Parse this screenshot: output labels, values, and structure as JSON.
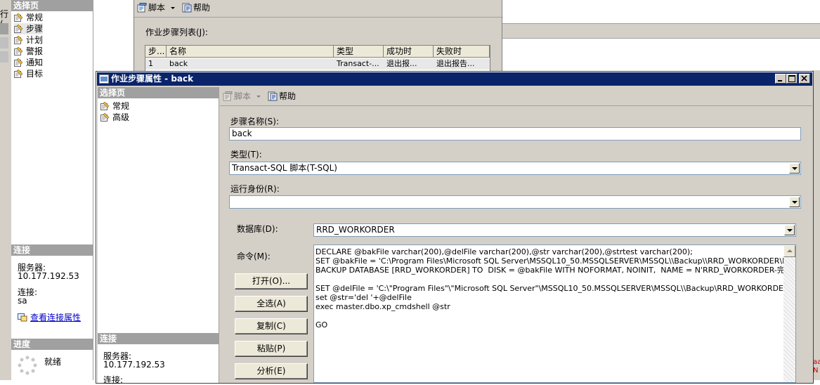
{
  "back_window": {
    "left_nav": {
      "header": "选择页",
      "items": [
        "常规",
        "步骤",
        "计划",
        "警报",
        "通知",
        "目标"
      ],
      "selected_index": 1,
      "edge_text": "行("
    },
    "toolbar": {
      "script_label": "脚本",
      "help_label": "帮助"
    },
    "steps_list_label": "作业步骤列表(J):",
    "grid": {
      "columns": [
        "步...",
        "名称",
        "类型",
        "成功时",
        "失败时"
      ],
      "rows": [
        [
          "1",
          "back",
          "Transact-...",
          "退出报...",
          "退出报告..."
        ]
      ]
    },
    "connection": {
      "header": "连接",
      "server_label": "服务器:",
      "server_value": "10.177.192.53",
      "conn_label": "连接:",
      "conn_value": "sa",
      "link": "查看连接属性"
    },
    "progress": {
      "header": "进度",
      "status": "就绪"
    }
  },
  "dialog": {
    "title": "作业步骤属性 - back",
    "left_nav": {
      "header": "选择页",
      "items": [
        "常规",
        "高级"
      ]
    },
    "toolbar": {
      "script_label": "脚本",
      "help_label": "帮助"
    },
    "step_name_label": "步骤名称(S):",
    "step_name_value": "back",
    "type_label": "类型(T):",
    "type_value": "Transact-SQL 脚本(T-SQL)",
    "run_as_label": "运行身份(R):",
    "run_as_value": "",
    "database_label": "数据库(D):",
    "database_value": "RRD_WORKORDER",
    "command_label": "命令(M):",
    "buttons": {
      "open": "打开(O)...",
      "select_all": "全选(A)",
      "copy": "复制(C)",
      "paste": "粘贴(P)",
      "parse": "分析(E)"
    },
    "command_lines": [
      "DECLARE @bakFile varchar(200),@delFile varchar(200),@str varchar(200),@strtest varchar(200);",
      "SET @bakFile = 'C:\\Program Files\\Microsoft SQL Server\\MSSQL10_50.MSSQLSERVER\\MSSQL\\\\Backup\\\\RRD_WORKORDER\\PMT_W",
      "BACKUP DATABASE [RRD_WORKORDER] TO  DISK = @bakFile WITH NOFORMAT, NOINIT,  NAME = N'RRD_WORKORDER-完整 数",
      "",
      "SET @delFile = 'C:\\\"Program Files\"\\\"Microsoft SQL Server\"\\MSSQL10_50.MSSQLSERVER\\MSSQL\\\\Backup\\RRD_WORKORDER\\PMT_",
      "set @str='del '+@delFile",
      "exec master.dbo.xp_cmdshell @str",
      "",
      "GO"
    ],
    "connection": {
      "header": "连接",
      "server_label": "服务器:",
      "server_value": "10.177.192.53",
      "conn_label": "连接:"
    }
  },
  "right_edge_text": "aa\nN",
  "colors": {
    "title_bar": "#0a246a",
    "panel_bg": "#d4d0c8",
    "header_bg": "#a0a0a0",
    "link": "#0000cc"
  }
}
